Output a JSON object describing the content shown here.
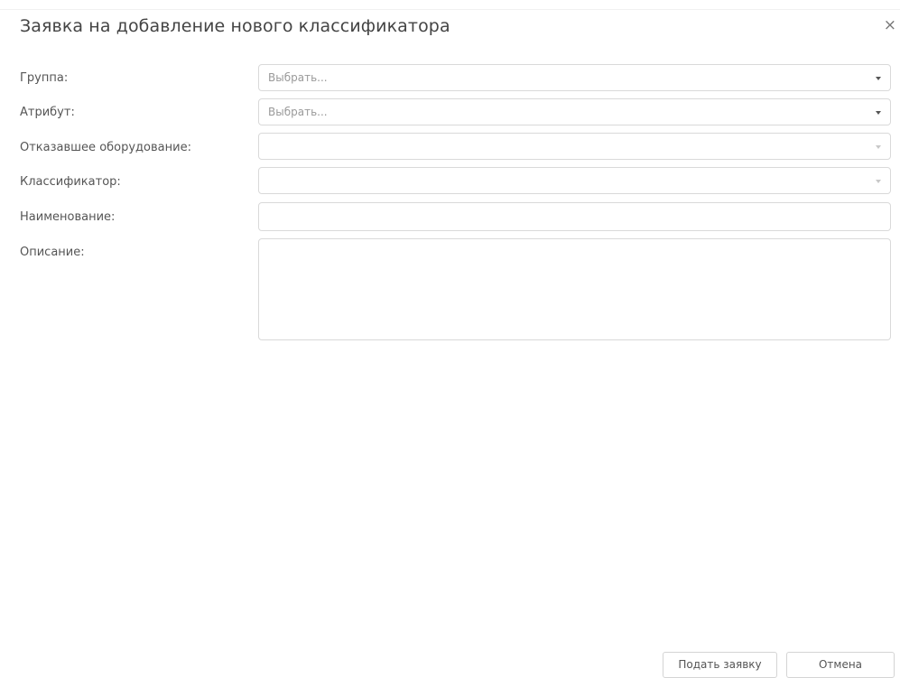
{
  "dialog": {
    "title": "Заявка на добавление нового классификатора",
    "close_label": "×"
  },
  "form": {
    "group": {
      "label": "Группа:",
      "value": "Выбрать..."
    },
    "attribute": {
      "label": "Атрибут:",
      "value": "Выбрать..."
    },
    "failed_equipment": {
      "label": "Отказавшее оборудование:",
      "value": ""
    },
    "classifier": {
      "label": "Классификатор:",
      "value": ""
    },
    "name": {
      "label": "Наименование:",
      "value": ""
    },
    "description": {
      "label": "Описание:",
      "value": ""
    }
  },
  "footer": {
    "submit_label": "Подать заявку",
    "cancel_label": "Отмена"
  },
  "icons": {
    "close": "close-icon",
    "dropdown": "chevron-down-icon"
  }
}
